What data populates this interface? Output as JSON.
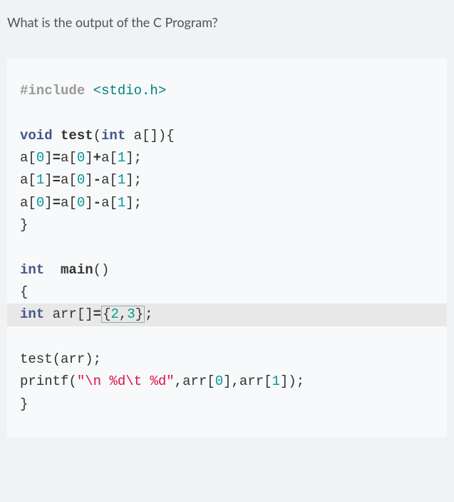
{
  "question": "What is the output of the C Program?",
  "code": {
    "l1_include": "#include",
    "l1_header": " <stdio.h>",
    "l2": "",
    "l3_void": "void",
    "l3_sp": " ",
    "l3_test": "test",
    "l3_p1": "(",
    "l3_int": "int",
    "l3_sp2": " ",
    "l3_a": "a",
    "l3_p2": "[]){",
    "l4_a": "a",
    "l4_b1": "[",
    "l4_n0": "0",
    "l4_b2": "]",
    "l4_op1": "=",
    "l4_a2": "a",
    "l4_b3": "[",
    "l4_n0b": "0",
    "l4_b4": "]",
    "l4_op2": "+",
    "l4_a3": "a",
    "l4_b5": "[",
    "l4_n1": "1",
    "l4_b6": "];",
    "l5_a": "a",
    "l5_b1": "[",
    "l5_n1": "1",
    "l5_b2": "]",
    "l5_op1": "=",
    "l5_a2": "a",
    "l5_b3": "[",
    "l5_n0": "0",
    "l5_b4": "]",
    "l5_op2": "-",
    "l5_a3": "a",
    "l5_b5": "[",
    "l5_n1b": "1",
    "l5_b6": "];",
    "l6_a": "a",
    "l6_b1": "[",
    "l6_n0": "0",
    "l6_b2": "]",
    "l6_op1": "=",
    "l6_a2": "a",
    "l6_b3": "[",
    "l6_n0b": "0",
    "l6_b4": "]",
    "l6_op2": "-",
    "l6_a3": "a",
    "l6_b5": "[",
    "l6_n1": "1",
    "l6_b6": "];",
    "l7": "}",
    "l8": "",
    "l9_int": "int",
    "l9_sp": "  ",
    "l9_main": "main",
    "l9_p": "()",
    "l10": "{",
    "l11_int": "int",
    "l11_sp": " ",
    "l11_arr": "arr",
    "l11_b1": "[]",
    "l11_op": "=",
    "l11_b2": "{",
    "l11_n2": "2",
    "l11_c": ",",
    "l11_n3": "3",
    "l11_b3": "}",
    "l11_semi": ";",
    "l12": "",
    "l13_test": "test",
    "l13_p1": "(",
    "l13_arr": "arr",
    "l13_p2": ");",
    "l14_printf": "printf",
    "l14_p1": "(",
    "l14_s": "\"\\n %d\\t %d\"",
    "l14_c1": ",",
    "l14_arr": "arr",
    "l14_b1": "[",
    "l14_n0": "0",
    "l14_b2": "],",
    "l14_arr2": "arr",
    "l14_b3": "[",
    "l14_n1": "1",
    "l14_b4": "]);",
    "l15": "}"
  }
}
